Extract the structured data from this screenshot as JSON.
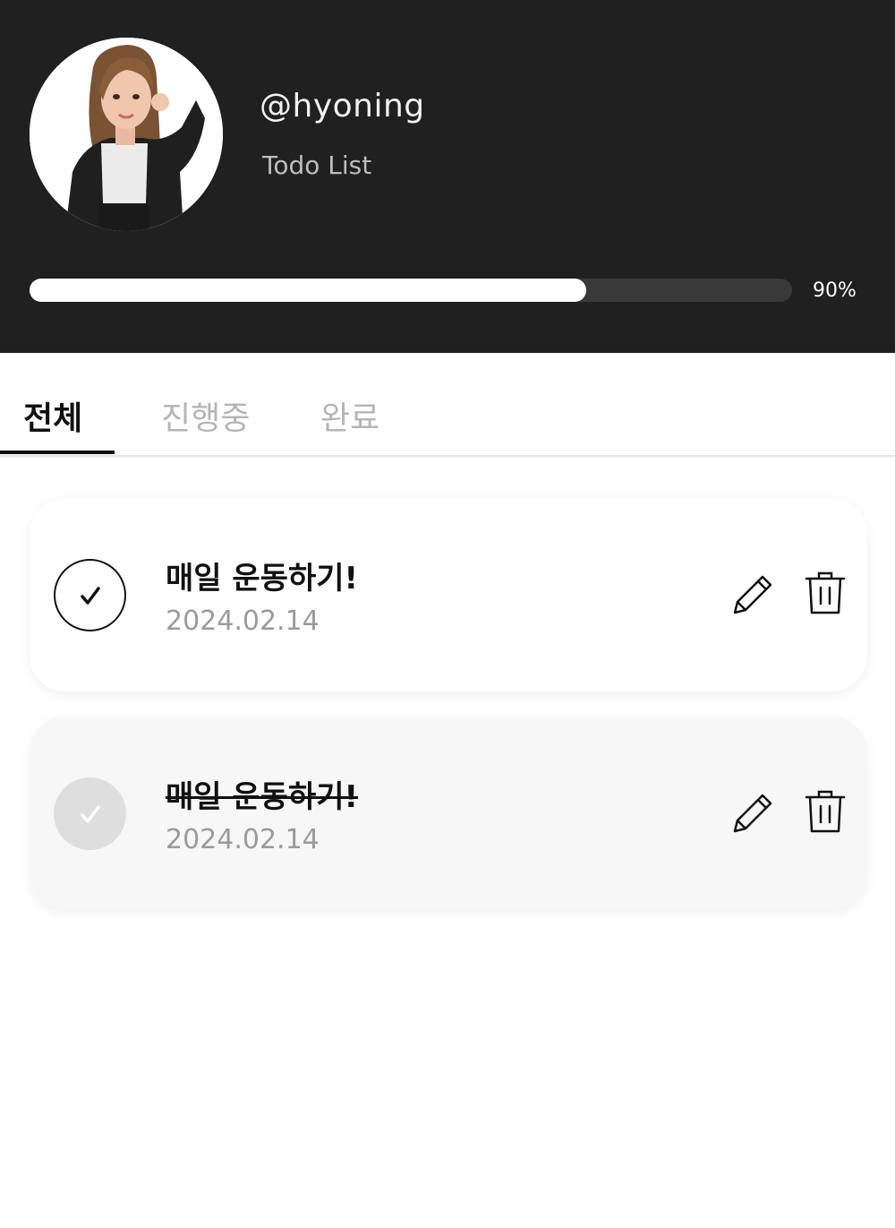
{
  "profile": {
    "username": "@hyoning",
    "subtitle": "Todo List"
  },
  "progress": {
    "value": 0.73,
    "label": "90%"
  },
  "tabs": [
    {
      "label": "전체",
      "active": true
    },
    {
      "label": "진행중",
      "active": false
    },
    {
      "label": "완료",
      "active": false
    }
  ],
  "todos": [
    {
      "title": "매일 운동하기!",
      "date": "2024.02.14",
      "completed": false
    },
    {
      "title": "매일 운동하기!",
      "date": "2024.02.14",
      "completed": true
    }
  ],
  "icons": {
    "check": "check-icon",
    "edit": "pencil-icon",
    "delete": "trash-icon"
  },
  "colors": {
    "header_bg": "#212020",
    "progress_fill": "#ffffff",
    "progress_track": "#3a3939",
    "completed_card_bg": "#f7f7f7"
  }
}
